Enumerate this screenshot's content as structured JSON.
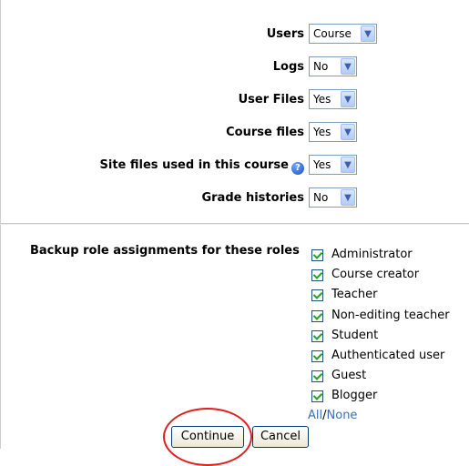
{
  "settings": [
    {
      "label": "Users",
      "value": "Course"
    },
    {
      "label": "Logs",
      "value": "No"
    },
    {
      "label": "User Files",
      "value": "Yes"
    },
    {
      "label": "Course files",
      "value": "Yes"
    },
    {
      "label": "Site files used in this course",
      "value": "Yes",
      "help": "?"
    },
    {
      "label": "Grade histories",
      "value": "No"
    }
  ],
  "roles": {
    "label": "Backup role assignments for these roles",
    "items": [
      {
        "label": "Administrator",
        "checked": true
      },
      {
        "label": "Course creator",
        "checked": true
      },
      {
        "label": "Teacher",
        "checked": true
      },
      {
        "label": "Non-editing teacher",
        "checked": true
      },
      {
        "label": "Student",
        "checked": true
      },
      {
        "label": "Authenticated user",
        "checked": true
      },
      {
        "label": "Guest",
        "checked": true
      },
      {
        "label": "Blogger",
        "checked": true
      }
    ],
    "all_link": "All",
    "separator": "/",
    "none_link": "None"
  },
  "buttons": {
    "continue": "Continue",
    "cancel": "Cancel"
  },
  "colors": {
    "link": "#3a70b8",
    "highlight_circle": "#e02020",
    "check": "#21a121"
  }
}
